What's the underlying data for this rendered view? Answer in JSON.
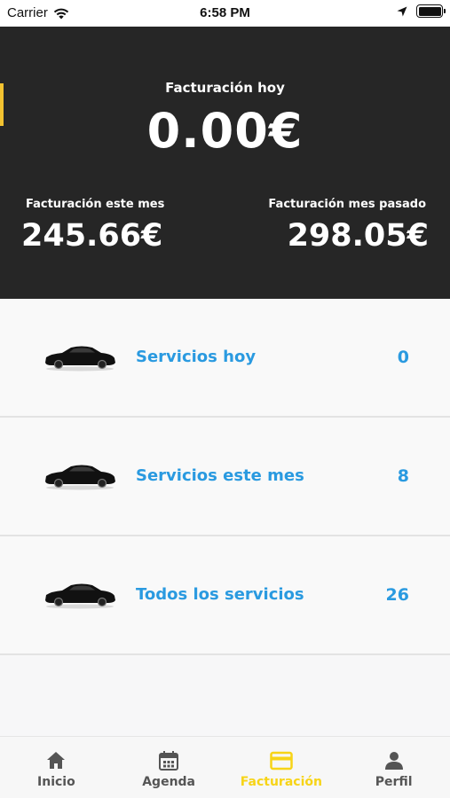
{
  "status_bar": {
    "carrier": "Carrier",
    "time": "6:58 PM",
    "icons": [
      "wifi-icon",
      "location-arrow-icon",
      "battery-icon"
    ]
  },
  "header": {
    "today_label": "Facturación hoy",
    "today_value": "0.00€",
    "month_label": "Facturación este mes",
    "month_value": "245.66€",
    "prev_month_label": "Facturación mes pasado",
    "prev_month_value": "298.05€"
  },
  "services": [
    {
      "icon": "car-icon",
      "label": "Servicios hoy",
      "count": "0"
    },
    {
      "icon": "car-icon",
      "label": "Servicios este mes",
      "count": "8"
    },
    {
      "icon": "car-icon",
      "label": "Todos los servicios",
      "count": "26"
    }
  ],
  "tabbar": {
    "active": "Facturación",
    "tabs": [
      {
        "icon": "home-icon",
        "label": "Inicio"
      },
      {
        "icon": "calendar-icon",
        "label": "Agenda"
      },
      {
        "icon": "card-icon",
        "label": "Facturación"
      },
      {
        "icon": "person-icon",
        "label": "Perfil"
      }
    ]
  },
  "colors": {
    "header_bg": "#262626",
    "accent_blue": "#2a9ae0",
    "active_tab": "#f7d417",
    "inactive_tab": "#555555"
  }
}
